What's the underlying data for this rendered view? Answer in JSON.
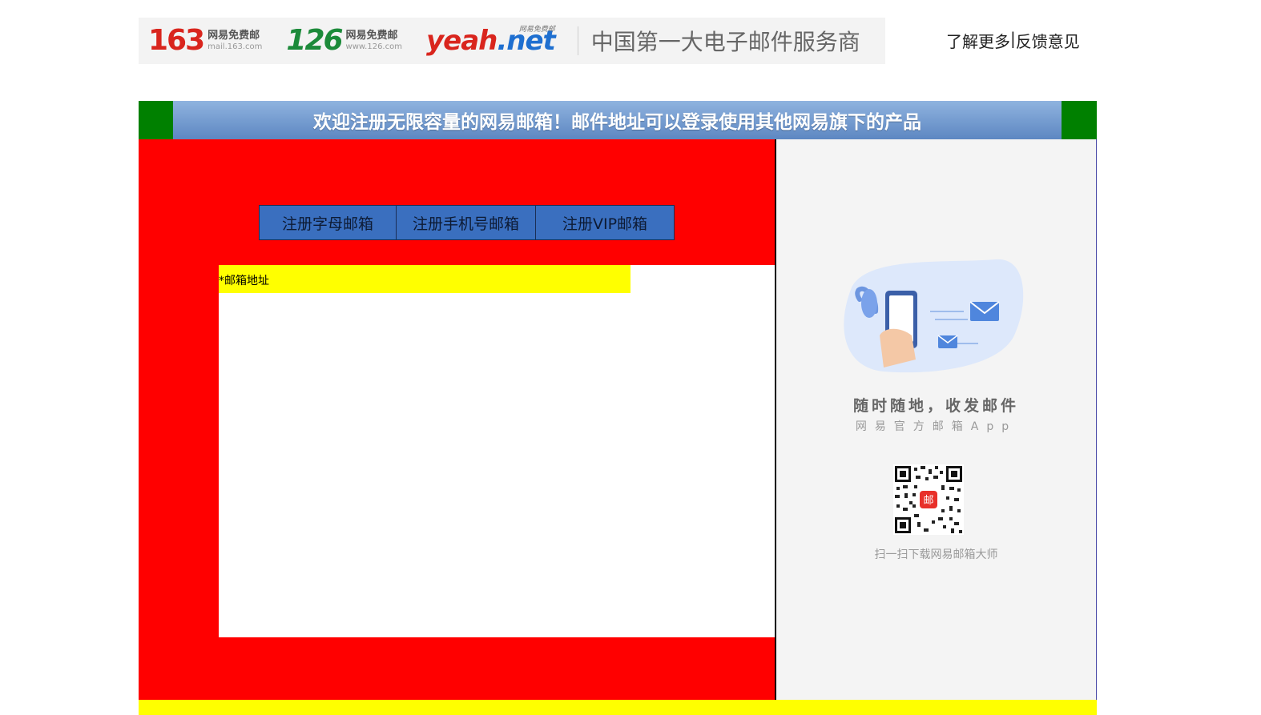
{
  "top": {
    "brand_163": {
      "number": "163",
      "cn": "网易免费邮",
      "url": "mail.163.com"
    },
    "brand_126": {
      "number": "126",
      "cn": "网易免费邮",
      "url": "www.126.com"
    },
    "brand_yeah": {
      "word": "yeah",
      "suffix": ".net",
      "tag": "网易免费邮"
    },
    "slogan": "中国第一大电子邮件服务商",
    "learn_more": "了解更多",
    "separator": "|",
    "feedback": "反馈意见"
  },
  "header": {
    "title": "欢迎注册无限容量的网易邮箱！邮件地址可以登录使用其他网易旗下的产品"
  },
  "tabs": [
    {
      "label": "注册字母邮箱"
    },
    {
      "label": "注册手机号邮箱"
    },
    {
      "label": "注册VIP邮箱"
    }
  ],
  "form": {
    "email_label": "*邮箱地址"
  },
  "side": {
    "app_title": "随时随地，收发邮件",
    "app_subtitle": "网易官方邮箱App",
    "qr_center": "邮",
    "qr_caption": "扫一扫下载网易邮箱大师"
  },
  "colors": {
    "header_outer": "#008000",
    "header_inner": "#6b92c9",
    "main_bg": "#ff0000",
    "label_bg": "#ffff00",
    "tab_bg": "#3a6fbf",
    "side_bg": "#f4f4f4"
  }
}
